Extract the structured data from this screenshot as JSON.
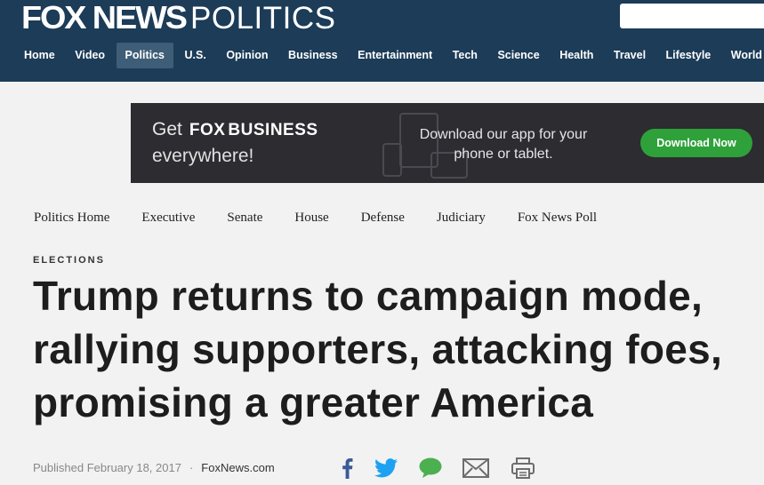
{
  "header": {
    "brand": "FOX NEWS",
    "section": "POLITICS",
    "search_placeholder": ""
  },
  "nav": {
    "items": [
      {
        "label": "Home"
      },
      {
        "label": "Video"
      },
      {
        "label": "Politics",
        "active": true
      },
      {
        "label": "U.S."
      },
      {
        "label": "Opinion"
      },
      {
        "label": "Business"
      },
      {
        "label": "Entertainment"
      },
      {
        "label": "Tech"
      },
      {
        "label": "Science"
      },
      {
        "label": "Health"
      },
      {
        "label": "Travel"
      },
      {
        "label": "Lifestyle"
      },
      {
        "label": "World"
      }
    ]
  },
  "ad": {
    "get": "Get",
    "brand_fox": "FOX",
    "brand_business": "BUSINESS",
    "everywhere": "everywhere!",
    "download_text": "Download our app for your phone or tablet.",
    "button_label": "Download Now",
    "button_color": "#2fa13a"
  },
  "subnav": {
    "items": [
      {
        "label": "Politics Home"
      },
      {
        "label": "Executive"
      },
      {
        "label": "Senate"
      },
      {
        "label": "House"
      },
      {
        "label": "Defense"
      },
      {
        "label": "Judiciary"
      },
      {
        "label": "Fox News Poll"
      }
    ]
  },
  "article": {
    "eyebrow": "ELECTIONS",
    "headline": "Trump returns to campaign mode, rallying supporters, attacking foes, promising a greater America",
    "published": "Published February 18, 2017",
    "separator": "·",
    "source": "FoxNews.com"
  },
  "share": {
    "icons": [
      "facebook-icon",
      "twitter-icon",
      "comment-icon",
      "email-icon",
      "print-icon"
    ],
    "colors": {
      "facebook": "#3b5998",
      "twitter": "#1da1f2",
      "comment": "#4caf50",
      "email": "#6d6d6d",
      "print": "#6d6d6d"
    }
  },
  "colors": {
    "header_bg": "#1c3c58",
    "nav_active_bg": "#3e5d77",
    "ad_bg": "#2c2c31",
    "page_bg": "#f2f2f2"
  }
}
